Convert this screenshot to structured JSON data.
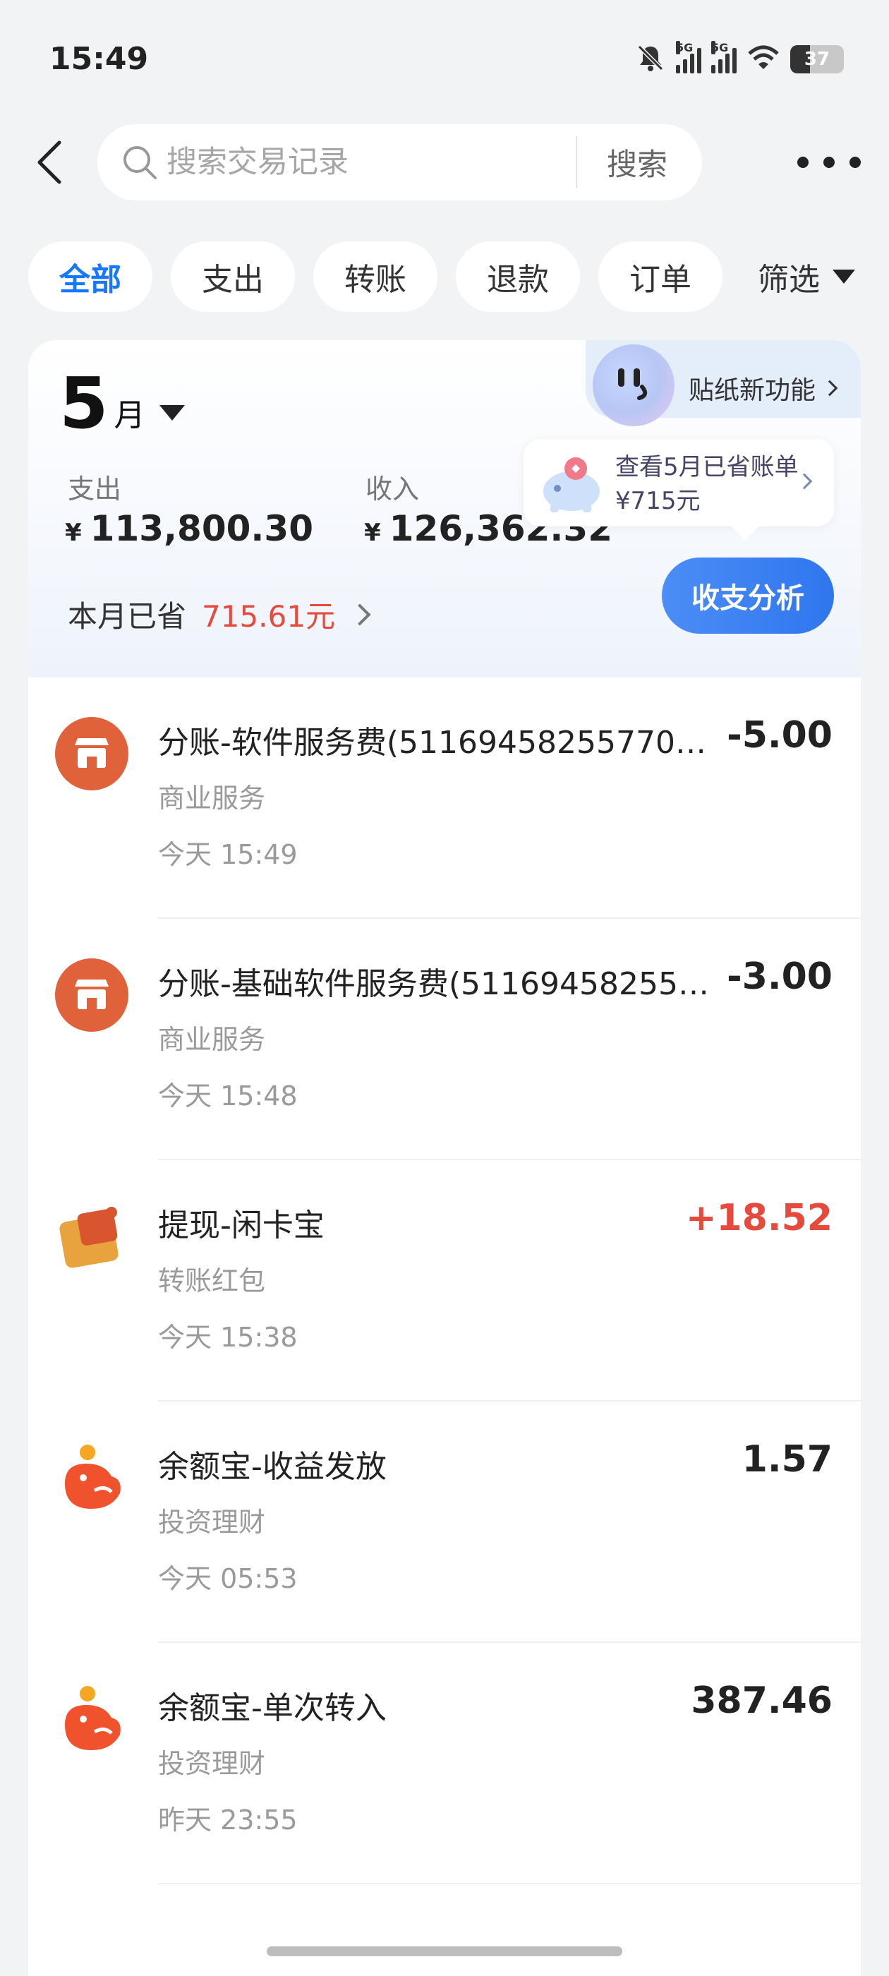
{
  "status_bar": {
    "time": "15:49",
    "network_1": "5G",
    "network_2": "5G",
    "battery": "37",
    "battery_fraction": 0.37
  },
  "header": {
    "search_placeholder": "搜索交易记录",
    "search_button": "搜索"
  },
  "filters": {
    "chips": [
      "全部",
      "支出",
      "转账",
      "退款",
      "订单"
    ],
    "active_index": 0,
    "dropdown_label": "筛选"
  },
  "summary": {
    "month": "5",
    "month_unit": "月",
    "expense_label": "支出",
    "expense_currency": "¥",
    "expense_amount": "113,800.30",
    "income_label": "收入",
    "income_currency": "¥",
    "income_amount": "126,362.32",
    "saved_label": "本月已省",
    "saved_value": "715.61元",
    "sticker_label": "贴纸新功能",
    "tooltip_text": "查看5月已省账单¥715元",
    "analysis_button": "收支分析"
  },
  "transactions": [
    {
      "title": "分账-软件服务费(5116945825577028...",
      "amount": "-5.00",
      "category": "商业服务",
      "time": "今天 15:49",
      "icon": "store-icon",
      "positive": false
    },
    {
      "title": "分账-基础软件服务费(511694582557...",
      "amount": "-3.00",
      "category": "商业服务",
      "time": "今天 15:48",
      "icon": "store-icon",
      "positive": false
    },
    {
      "title": "提现-闲卡宝",
      "amount": "+18.52",
      "category": "转账红包",
      "time": "今天 15:38",
      "icon": "wallet-icon",
      "positive": true
    },
    {
      "title": "余额宝-收益发放",
      "amount": "1.57",
      "category": "投资理财",
      "time": "今天 05:53",
      "icon": "yuebao-icon",
      "positive": false
    },
    {
      "title": "余额宝-单次转入",
      "amount": "387.46",
      "category": "投资理财",
      "time": "昨天 23:55",
      "icon": "yuebao-icon",
      "positive": false
    }
  ],
  "colors": {
    "accent": "#1677ff",
    "positive_amount": "#e54a3c",
    "saved_value": "#e54a3c",
    "store_icon": "#e0623a",
    "wallet_icon": "#e8a23e",
    "yuebao_icon": "#f0522e"
  }
}
